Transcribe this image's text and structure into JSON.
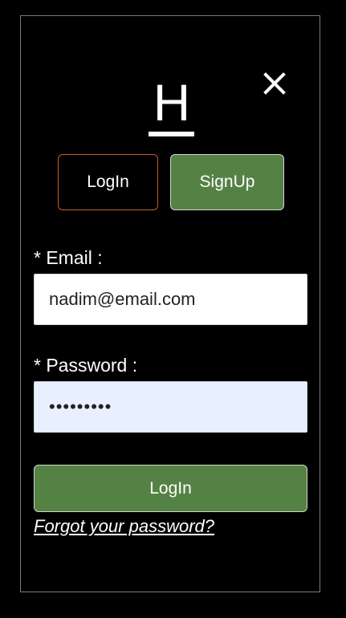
{
  "logo": {
    "letter": "H"
  },
  "close_icon": "close-icon",
  "tabs": {
    "login_label": "LogIn",
    "signup_label": "SignUp"
  },
  "form": {
    "email_label": "* Email :",
    "email_value": "nadim@email.com",
    "password_label": "* Password :",
    "password_value": "•••••••••",
    "submit_label": "LogIn",
    "forgot_label": "Forgot your password?"
  },
  "colors": {
    "background": "#000000",
    "accent_green": "#548245",
    "login_tab_border": "#c0602a",
    "password_autofill_bg": "#e8f0fe"
  }
}
